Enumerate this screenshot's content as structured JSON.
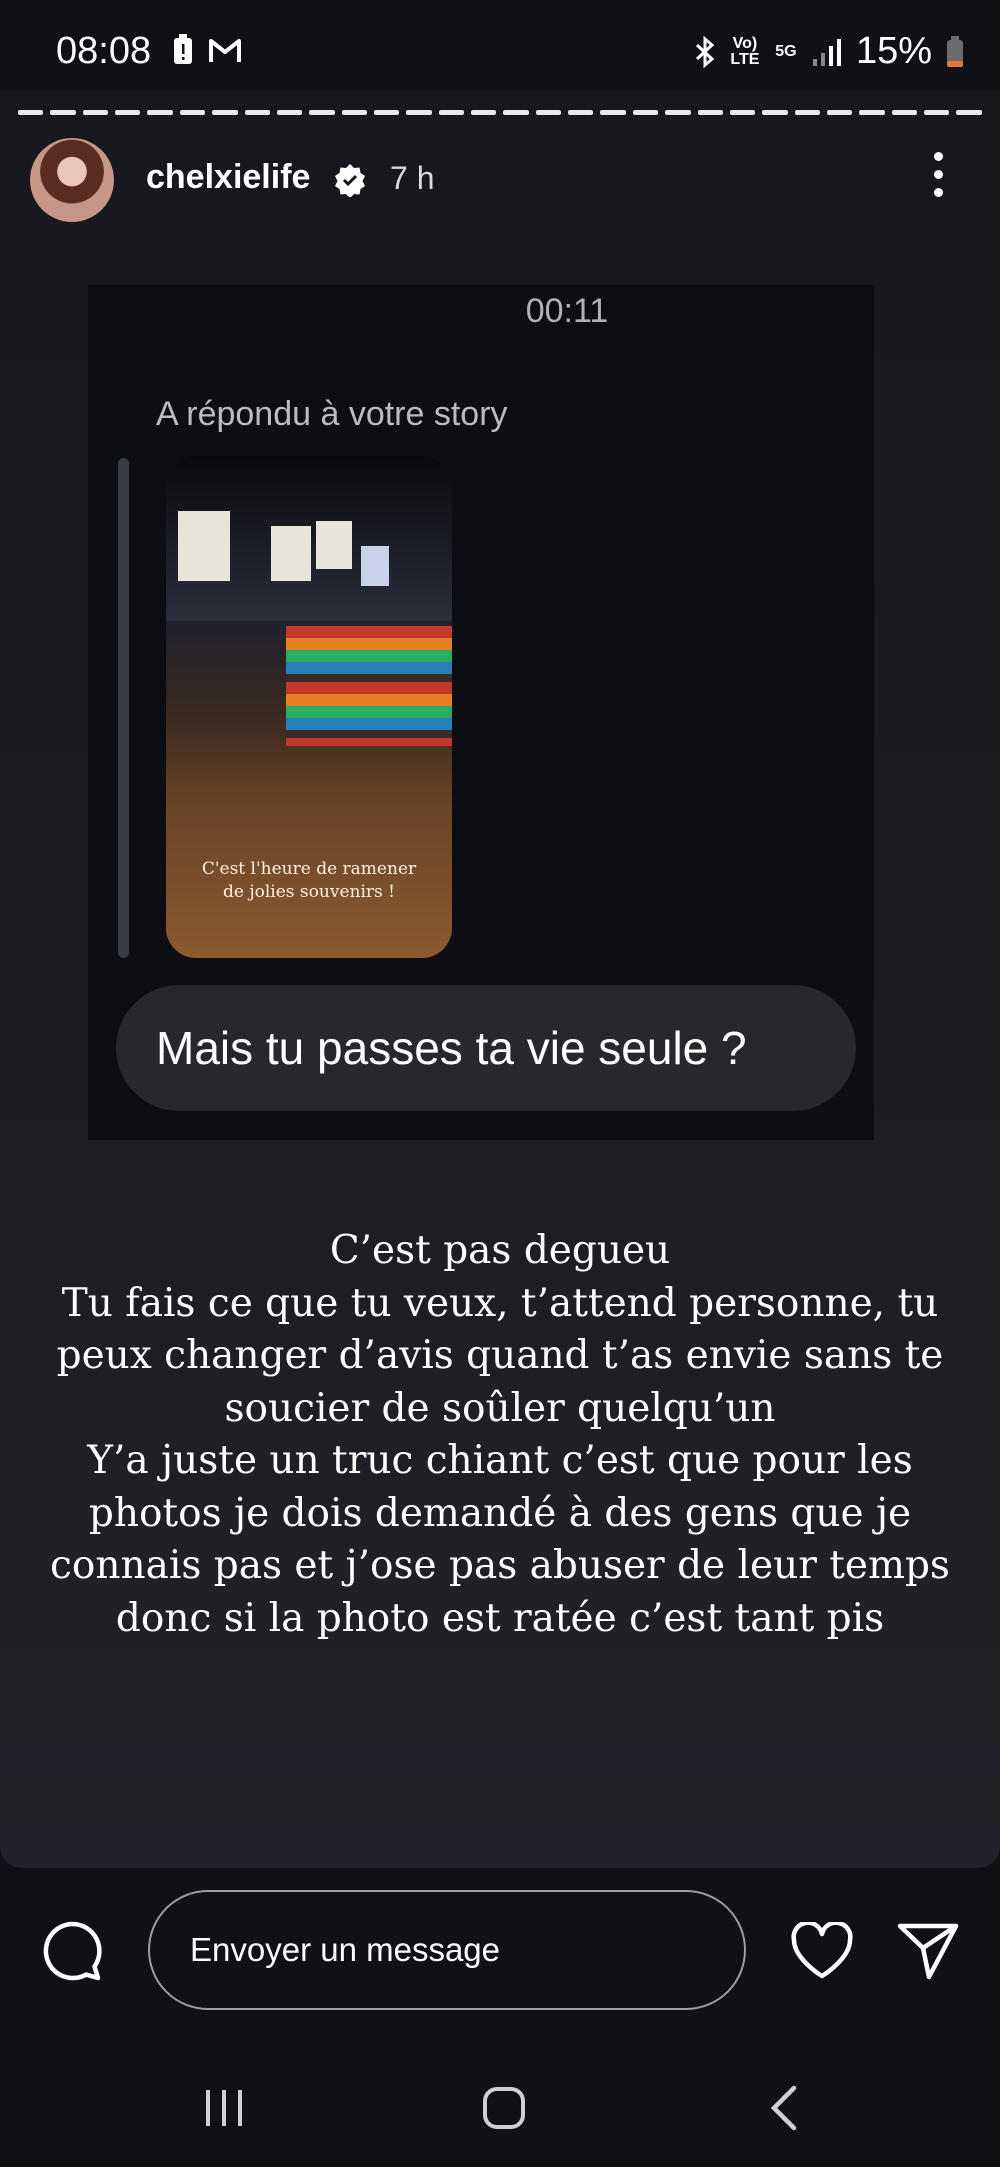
{
  "status_bar": {
    "time": "08:08",
    "network_volte": "Vo) LTE",
    "network_5g": "5G",
    "battery": "15%"
  },
  "story": {
    "username": "chelxielife",
    "time_ago": "7 h",
    "progress_segments": 30
  },
  "chat": {
    "timestamp": "00:11",
    "replied_label": "A répondu à votre story",
    "thumbnail_caption": [
      "C'est l'heure de ramener",
      "de jolies souvenirs !"
    ],
    "message": "Mais tu passes ta vie seule ?"
  },
  "caption_lines": [
    "C’est pas degueu",
    "Tu fais ce que tu veux, t’attend personne, tu",
    "peux changer d’avis quand t’as envie sans te",
    "soucier de soûler quelqu’un",
    "Y’a juste un truc chiant c’est que pour les",
    "photos je dois demandé à des gens que je",
    "connais pas et j’ose pas abuser de leur temps",
    "donc si la photo est ratée c’est tant pis"
  ],
  "reply_bar": {
    "placeholder": "Envoyer un message"
  },
  "icons": {
    "comment": "chat-bubble-icon",
    "like": "heart-icon",
    "share": "send-icon",
    "more": "more-vertical-icon",
    "verified": "verified-badge-icon"
  }
}
